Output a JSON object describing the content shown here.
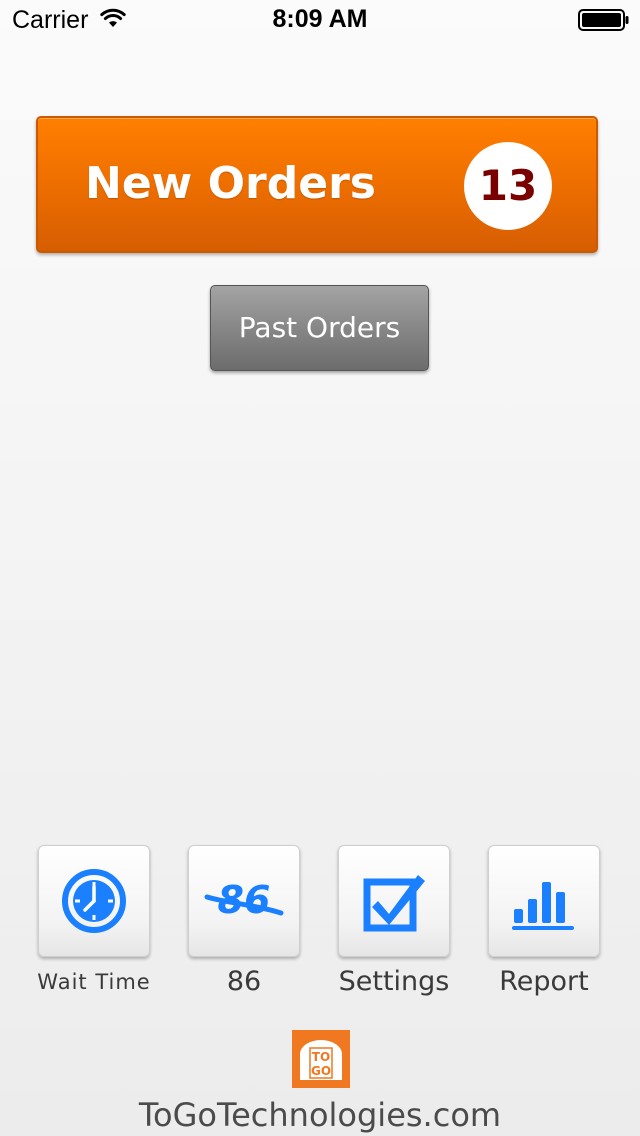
{
  "status_bar": {
    "carrier": "Carrier",
    "time": "8:09 AM",
    "wifi_icon": "wifi-icon",
    "battery_icon": "battery-full-icon"
  },
  "orders": {
    "new_label": "New Orders",
    "new_count": "13",
    "past_label": "Past Orders"
  },
  "tools": [
    {
      "label": "Wait  Time",
      "icon": "clock-icon"
    },
    {
      "label": "86",
      "icon": "86-strikethrough-icon"
    },
    {
      "label": "Settings",
      "icon": "checkbox-icon"
    },
    {
      "label": "Report",
      "icon": "bar-chart-icon"
    }
  ],
  "footer": {
    "logo_icon": "togo-logo-icon",
    "logo_text": "TOGO",
    "url": "ToGoTechnologies.com"
  },
  "colors": {
    "accent_orange": "#f07000",
    "badge_text": "#7a0000",
    "icon_blue": "#1a80ff",
    "past_orders_gray": "#878787"
  }
}
